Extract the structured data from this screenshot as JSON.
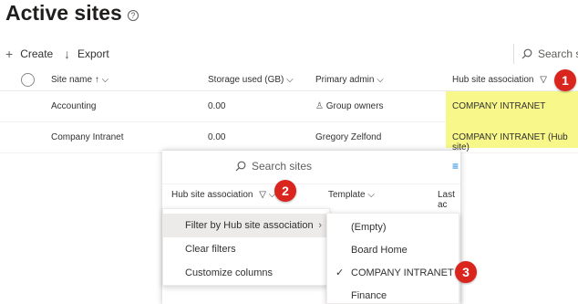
{
  "page": {
    "title": "Active sites",
    "info_icon": "info-icon"
  },
  "toolbar": {
    "create_label": "Create",
    "export_label": "Export",
    "search_placeholder": "Search si"
  },
  "table": {
    "headers": {
      "site_name": "Site name",
      "storage": "Storage used (GB)",
      "admin": "Primary admin",
      "hub": "Hub site association"
    },
    "rows": [
      {
        "site_name": "Accounting",
        "storage": "0.00",
        "admin": "Group owners",
        "hub": "COMPANY INTRANET"
      },
      {
        "site_name": "Company Intranet",
        "storage": "0.00",
        "admin": "Gregory Zelfond",
        "hub": "COMPANY INTRANET (Hub site)"
      }
    ]
  },
  "panel": {
    "search_placeholder": "Search sites",
    "headers": {
      "hub": "Hub site association",
      "template": "Template",
      "last": "Last ac"
    }
  },
  "menu1": {
    "items": [
      "Filter by Hub site association",
      "Clear filters",
      "Customize columns"
    ]
  },
  "menu2": {
    "items": [
      "(Empty)",
      "Board Home",
      "COMPANY INTRANET",
      "Finance"
    ],
    "checked": "COMPANY INTRANET"
  },
  "annotations": {
    "badge1": "1",
    "badge2": "2",
    "badge3": "3"
  },
  "colors": {
    "highlight": "#f7f78a",
    "badge": "#d9251d",
    "accent": "#0078d4"
  }
}
